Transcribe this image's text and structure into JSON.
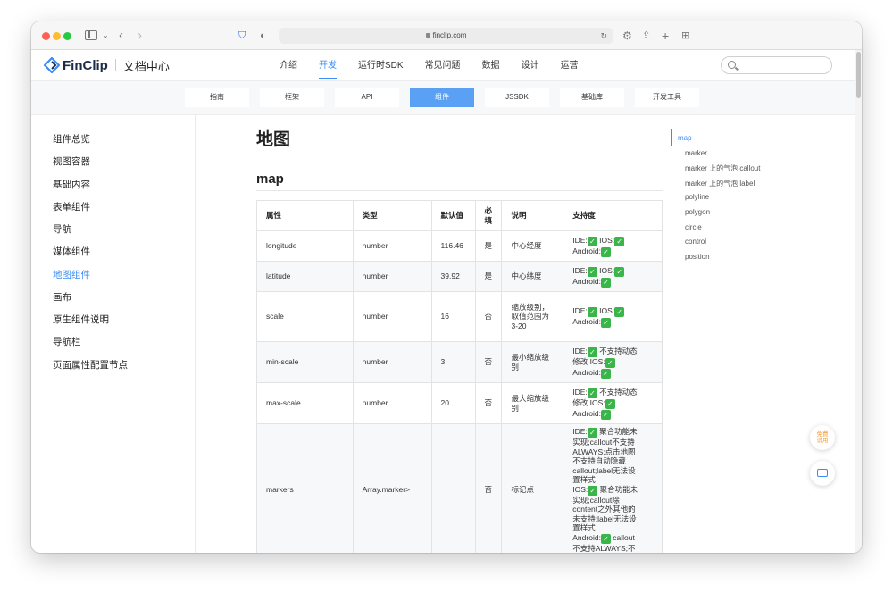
{
  "browser": {
    "url": "finclip.com"
  },
  "header": {
    "logo_text": "FinClip",
    "logo_sub": "文档中心",
    "nav": [
      "介绍",
      "开发",
      "运行时SDK",
      "常见问题",
      "数据",
      "设计",
      "运营"
    ]
  },
  "subnav": [
    "指南",
    "框架",
    "API",
    "组件",
    "JSSDK",
    "基础库",
    "开发工具"
  ],
  "sidebar": [
    "组件总览",
    "视图容器",
    "基础内容",
    "表单组件",
    "导航",
    "媒体组件",
    "地图组件",
    "画布",
    "原生组件说明",
    "导航栏",
    "页面属性配置节点"
  ],
  "page": {
    "title": "地图",
    "section": "map"
  },
  "table": {
    "headers": [
      "属性",
      "类型",
      "默认值",
      "必填",
      "说明",
      "支持度"
    ],
    "rows": [
      {
        "attr": "longitude",
        "type": "number",
        "default": "116.46",
        "required": "是",
        "desc": "中心经度",
        "support": [
          "IDE:✅ IOS:✅",
          "Android:✅"
        ]
      },
      {
        "attr": "latitude",
        "type": "number",
        "default": "39.92",
        "required": "是",
        "desc": "中心纬度",
        "support": [
          "IDE:✅ IOS:✅",
          "Android:✅"
        ]
      },
      {
        "attr": "scale",
        "type": "number",
        "default": "16",
        "required": "否",
        "desc": "缩放级别，取值范围为3-20",
        "support": [
          "IDE:✅ IOS:✅",
          "Android:✅"
        ]
      },
      {
        "attr": "min-scale",
        "type": "number",
        "default": "3",
        "required": "否",
        "desc": "最小缩放级别",
        "support": [
          "IDE:✅ 不支持动态",
          "修改 IOS:✅",
          "Android:✅"
        ]
      },
      {
        "attr": "max-scale",
        "type": "number",
        "default": "20",
        "required": "否",
        "desc": "最大缩放级别",
        "support": [
          "IDE:✅ 不支持动态",
          "修改 IOS:✅",
          "Android:✅"
        ]
      },
      {
        "attr": "markers",
        "type": "Array.marker>",
        "default": "",
        "required": "否",
        "desc": "标记点",
        "support": [
          "IDE:✅ 聚合功能未",
          "实现;callout不支持",
          "ALWAYS;点击地图",
          "不支持自动隐藏",
          "callout;label无法设",
          "置样式",
          "IOS:✅ 聚合功能未",
          "实现;callout除",
          "content之外其他的",
          "未支持;label无法设",
          "置样式",
          "Android:✅ callout",
          "不支持ALWAYS;不"
        ]
      }
    ]
  },
  "toc": [
    "map",
    "marker",
    "marker 上的气泡 callout",
    "marker 上的气泡 label",
    "polyline",
    "polygon",
    "circle",
    "control",
    "position"
  ],
  "floating": {
    "trial_label": "免费试用"
  }
}
